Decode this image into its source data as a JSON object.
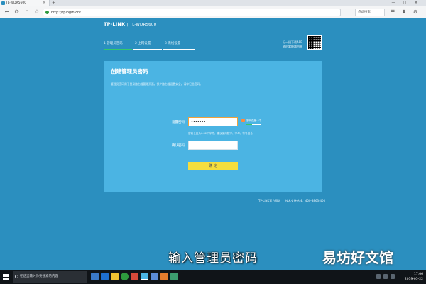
{
  "browser": {
    "tab_title": "TL-WDR5600",
    "new_tab": "+",
    "tab_close": "×",
    "url": "http://tplogin.cn/",
    "search_placeholder": "点此搜索",
    "window_buttons": [
      "—",
      "□",
      "×"
    ],
    "nav": [
      "←",
      "⟳",
      "⌂",
      "☆"
    ],
    "toolbar_icons": [
      "☰",
      "⬇",
      "⚙"
    ]
  },
  "header": {
    "brand": "TP-LINK",
    "model": "TL-WDR5600"
  },
  "steps": [
    {
      "label": "1 管理员密码",
      "active": true
    },
    {
      "label": "2 上网设置",
      "active": false
    },
    {
      "label": "3 无线设置",
      "active": false
    }
  ],
  "qr": {
    "line1": "扫一扫下载APP",
    "line2": "随时掌握路由器"
  },
  "panel": {
    "title": "创建管理员密码",
    "description": "管理员密码用于登录路由器管理页面，保护路由器设置安全，请牢记此密码。",
    "password_label": "设置密码",
    "password_value": "•••••••",
    "strength_label": "密码强度：中",
    "strength_fraction": 0.4,
    "hint": "密码长度为6-32个字符，建议使用数字、字母、符号组合",
    "confirm_label": "确认密码",
    "confirm_value": "",
    "button_label": "确 定"
  },
  "footer": {
    "text": "TP-LINK官方网站 ｜ 技术支持热线：400-8863-400"
  },
  "overlay": {
    "subtitle": "输入管理员密码",
    "watermark": "易坊好文馆"
  },
  "taskbar": {
    "search_placeholder": "在这里输入你要搜索的内容",
    "time": "17:06",
    "date": "2019-05-22"
  },
  "colors": {
    "page_bg": "#2b8fbf",
    "panel_bg": "#4bb4e3",
    "button_bg": "#f5de3d",
    "step_active": "#35c86b"
  }
}
